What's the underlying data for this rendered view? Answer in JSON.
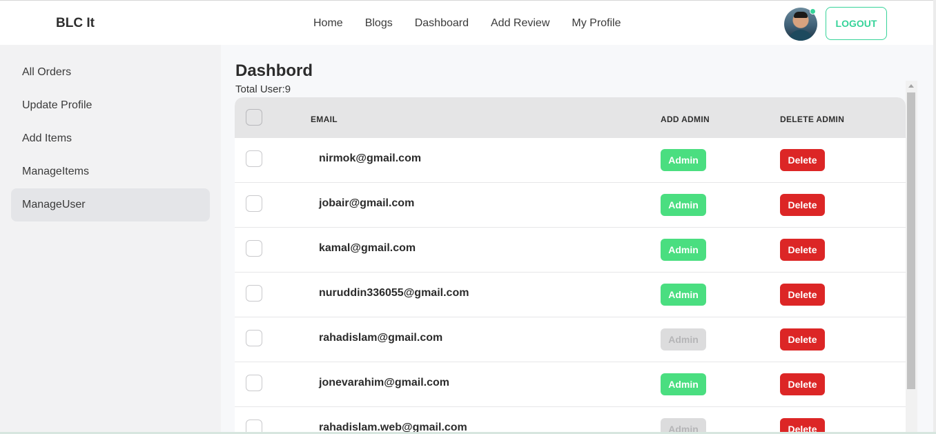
{
  "navbar": {
    "brand": "BLC It",
    "links": [
      "Home",
      "Blogs",
      "Dashboard",
      "Add Review",
      "My Profile"
    ],
    "logout_label": "LOGOUT",
    "accent_color": "#36d399"
  },
  "sidebar": {
    "items": [
      {
        "label": "All Orders",
        "active": false
      },
      {
        "label": "Update Profile",
        "active": false
      },
      {
        "label": "Add Items",
        "active": false
      },
      {
        "label": "ManageItems",
        "active": false
      },
      {
        "label": "ManageUser",
        "active": true
      }
    ]
  },
  "main": {
    "title": "Dashbord",
    "total_users": "Total User:9",
    "table": {
      "headers": {
        "email": "EMAIL",
        "add_admin": "ADD ADMIN",
        "delete_admin": "DELETE ADMIN"
      },
      "admin_label": "Admin",
      "delete_label": "Delete",
      "rows": [
        {
          "email": "nirmok@gmail.com",
          "is_admin": false
        },
        {
          "email": "jobair@gmail.com",
          "is_admin": false
        },
        {
          "email": "kamal@gmail.com",
          "is_admin": false
        },
        {
          "email": "nuruddin336055@gmail.com",
          "is_admin": false
        },
        {
          "email": "rahadislam@gmail.com",
          "is_admin": true
        },
        {
          "email": "jonevarahim@gmail.com",
          "is_admin": false
        },
        {
          "email": "rahadislam.web@gmail.com",
          "is_admin": true
        }
      ]
    }
  },
  "colors": {
    "admin_button": "#4ade80",
    "admin_button_disabled": "#dcdcdd",
    "delete_button": "#dc2626"
  }
}
